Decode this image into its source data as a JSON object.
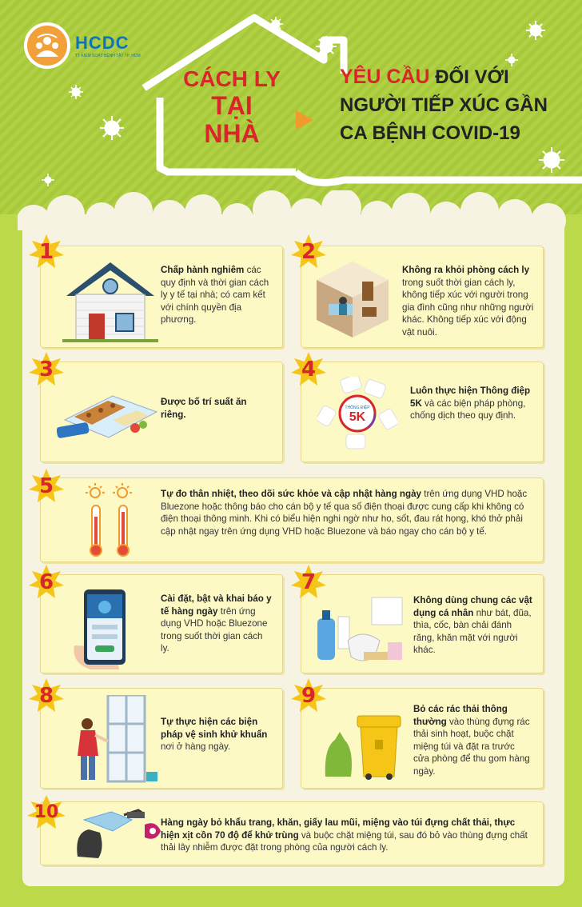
{
  "logo": {
    "name": "HCDC",
    "subtitle": "TT KIỂM SOÁT BỆNH TẬT TP. HCM"
  },
  "title": {
    "left_line1": "CÁCH LY",
    "left_line2": "TẠI",
    "left_line3": "NHÀ",
    "right_red": "YÊU CẦU",
    "right_line1_rest": "ĐỐI VỚI",
    "right_line2": "NGƯỜI TIẾP XÚC GẦN",
    "right_line3": "CA BỆNH COVID-19"
  },
  "items": [
    {
      "number": "1",
      "bold": "Chấp hành nghiêm",
      "text": " các quy định và thời gian cách ly y tế tại nhà; có cam kết với chính quyền địa phương."
    },
    {
      "number": "2",
      "bold": "Không ra khỏi phòng cách ly",
      "text": " trong suốt thời gian cách ly, không tiếp xúc với người trong gia đình cũng như những người khác. Không tiếp xúc với động vật nuôi."
    },
    {
      "number": "3",
      "bold": "Được bố trí suất ăn riêng.",
      "text": ""
    },
    {
      "number": "4",
      "bold": "Luôn thực hiện Thông điệp 5K",
      "text": " và các biện pháp phòng, chống dịch theo quy định."
    },
    {
      "number": "5",
      "bold": "Tự đo thân nhiệt, theo dõi sức khỏe và cập nhật hàng ngày",
      "text": " trên ứng dụng VHD hoặc Bluezone hoặc thông báo cho cán bộ y tế qua số điện thoại được cung cấp khi không có điện thoại thông minh. Khi có biểu hiện nghi ngờ như ho, sốt, đau rát họng, khó thở phải cập nhật ngay trên ứng dụng VHD hoặc Bluezone và báo ngay cho cán bộ y tế."
    },
    {
      "number": "6",
      "bold": "Cài đặt, bật và khai báo y tế hàng ngày",
      "text": " trên ứng dụng VHD hoặc Bluezone trong suốt thời gian cách ly."
    },
    {
      "number": "7",
      "bold": "Không dùng chung các vật dụng cá nhân",
      "text": " như bát, đũa, thìa, cốc, bàn chải đánh răng, khăn mặt với người khác."
    },
    {
      "number": "8",
      "bold": "Tự thực hiện các biện pháp vệ sinh khử khuẩn",
      "text": " nơi ở hàng ngày."
    },
    {
      "number": "9",
      "bold": "Bỏ các rác thải thông thường",
      "text": " vào thùng đựng rác thải sinh hoạt, buộc chặt miệng túi và đặt ra trước cửa phòng để thu gom hàng ngày."
    },
    {
      "number": "10",
      "bold": "Hàng ngày bỏ khẩu trang, khăn, giấy lau mũi, miệng vào túi đựng chất thải, thực hiện xịt cồn 70 độ để khử trùng",
      "text": " và buộc chặt miệng túi, sau đó bỏ vào thùng đựng chất thải lây nhiễm được đặt trong phòng của người cách ly."
    }
  ],
  "badge_5k": {
    "center_label": "THÔNG ĐIỆP",
    "center_value": "5K"
  },
  "colors": {
    "accent_red": "#d8262b",
    "lime": "#bcd94a",
    "card_bg": "#fdf9c4",
    "number_yellow": "#f5c518"
  },
  "icons": [
    "house-icon",
    "quarantine-room-icon",
    "meal-box-icon",
    "5k-badge-icon",
    "thermometer-icon",
    "phone-app-icon",
    "personal-items-icon",
    "cleaning-icon",
    "trash-bin-icon",
    "mask-disposal-icon",
    "virus-icon",
    "arrow-right-icon"
  ]
}
